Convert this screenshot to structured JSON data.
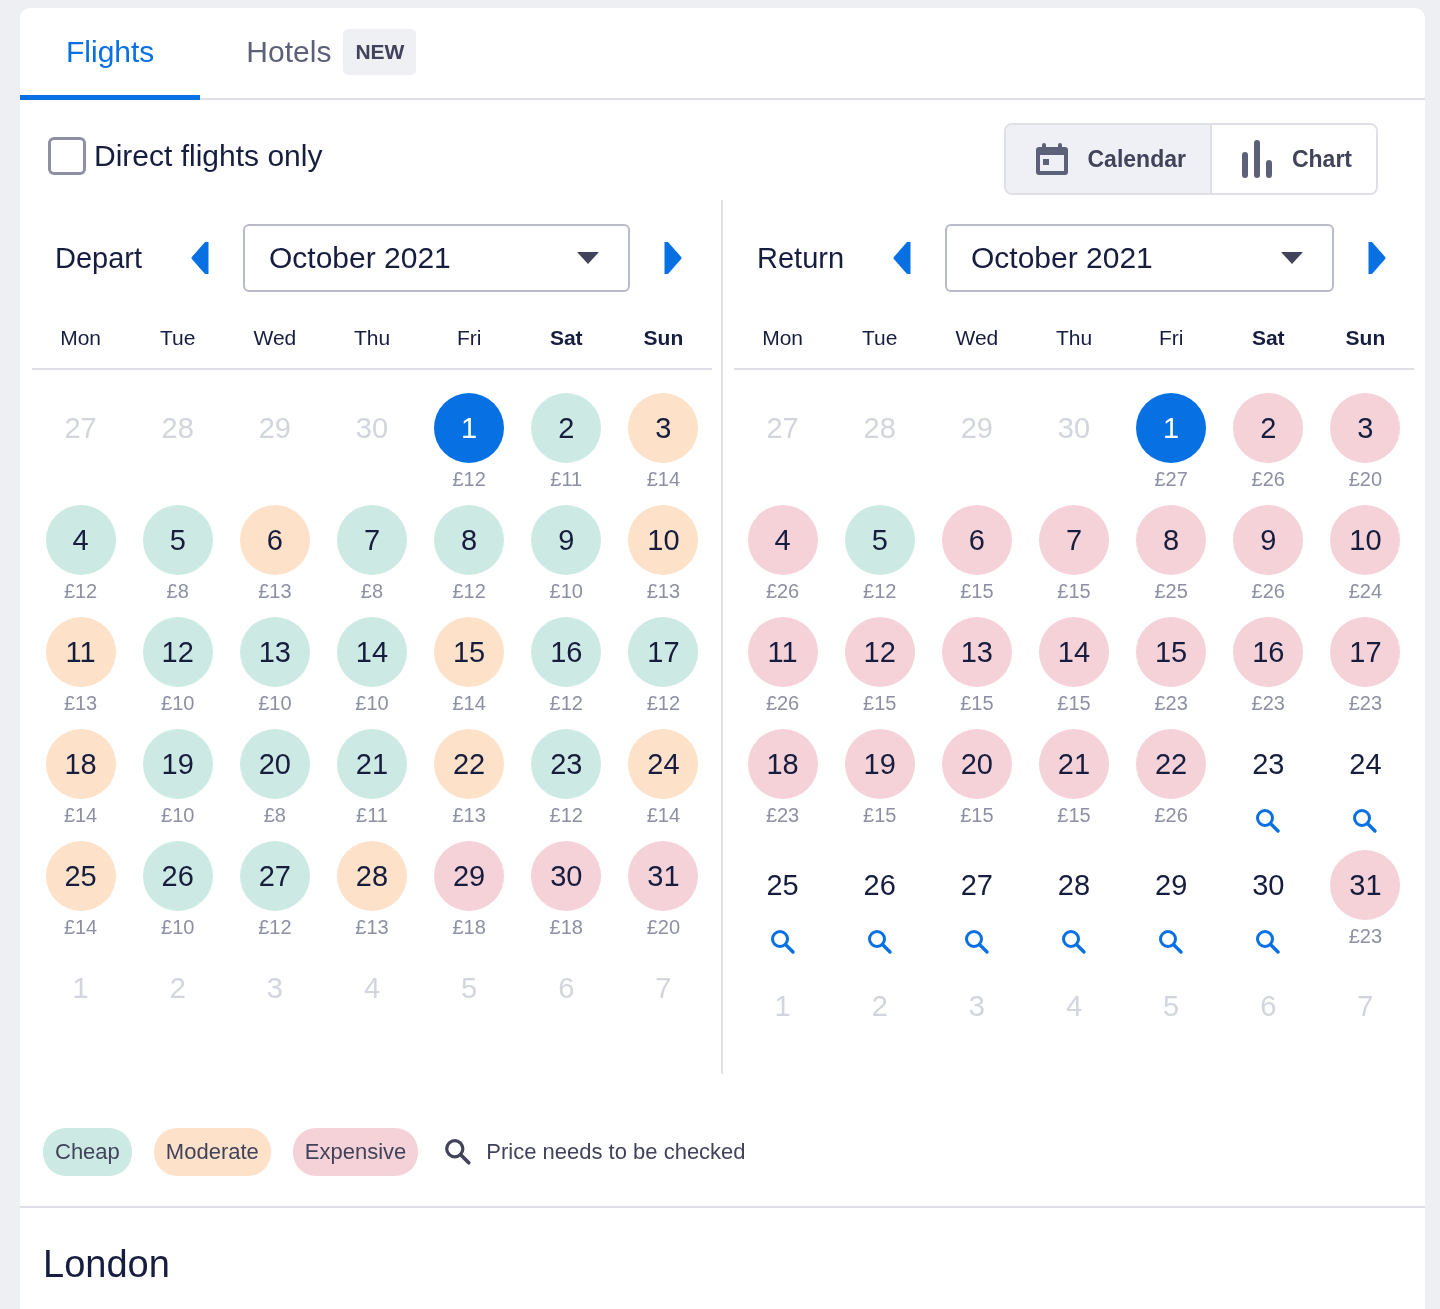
{
  "tabs": [
    {
      "label": "Flights",
      "selected": true
    },
    {
      "label": "Hotels",
      "selected": false,
      "badge": "NEW"
    }
  ],
  "direct_only": {
    "label": "Direct flights only",
    "checked": false
  },
  "view_toggle": [
    {
      "label": "Calendar",
      "kind": "calendar",
      "selected": true
    },
    {
      "label": "Chart",
      "kind": "chart",
      "selected": false
    }
  ],
  "calendars": [
    {
      "label": "Depart",
      "month": "October 2021",
      "weekdays": [
        {
          "label": "Mon",
          "weekend": false
        },
        {
          "label": "Tue",
          "weekend": false
        },
        {
          "label": "Wed",
          "weekend": false
        },
        {
          "label": "Thu",
          "weekend": false
        },
        {
          "label": "Fri",
          "weekend": false
        },
        {
          "label": "Sat",
          "weekend": true
        },
        {
          "label": "Sun",
          "weekend": true
        }
      ],
      "days": [
        {
          "day": "27",
          "kind": "outside",
          "selected": false
        },
        {
          "day": "28",
          "kind": "outside",
          "selected": false
        },
        {
          "day": "29",
          "kind": "outside",
          "selected": false
        },
        {
          "day": "30",
          "kind": "outside",
          "selected": false
        },
        {
          "day": "1",
          "kind": "plain",
          "price": "£12",
          "selected": true
        },
        {
          "day": "2",
          "kind": "cheap",
          "price": "£11",
          "selected": false
        },
        {
          "day": "3",
          "kind": "moderate",
          "price": "£14",
          "selected": false
        },
        {
          "day": "4",
          "kind": "cheap",
          "price": "£12",
          "selected": false
        },
        {
          "day": "5",
          "kind": "cheap",
          "price": "£8",
          "selected": false
        },
        {
          "day": "6",
          "kind": "moderate",
          "price": "£13",
          "selected": false
        },
        {
          "day": "7",
          "kind": "cheap",
          "price": "£8",
          "selected": false
        },
        {
          "day": "8",
          "kind": "cheap",
          "price": "£12",
          "selected": false
        },
        {
          "day": "9",
          "kind": "cheap",
          "price": "£10",
          "selected": false
        },
        {
          "day": "10",
          "kind": "moderate",
          "price": "£13",
          "selected": false
        },
        {
          "day": "11",
          "kind": "moderate",
          "price": "£13",
          "selected": false
        },
        {
          "day": "12",
          "kind": "cheap",
          "price": "£10",
          "selected": false
        },
        {
          "day": "13",
          "kind": "cheap",
          "price": "£10",
          "selected": false
        },
        {
          "day": "14",
          "kind": "cheap",
          "price": "£10",
          "selected": false
        },
        {
          "day": "15",
          "kind": "moderate",
          "price": "£14",
          "selected": false
        },
        {
          "day": "16",
          "kind": "cheap",
          "price": "£12",
          "selected": false
        },
        {
          "day": "17",
          "kind": "cheap",
          "price": "£12",
          "selected": false
        },
        {
          "day": "18",
          "kind": "moderate",
          "price": "£14",
          "selected": false
        },
        {
          "day": "19",
          "kind": "cheap",
          "price": "£10",
          "selected": false
        },
        {
          "day": "20",
          "kind": "cheap",
          "price": "£8",
          "selected": false
        },
        {
          "day": "21",
          "kind": "cheap",
          "price": "£11",
          "selected": false
        },
        {
          "day": "22",
          "kind": "moderate",
          "price": "£13",
          "selected": false
        },
        {
          "day": "23",
          "kind": "cheap",
          "price": "£12",
          "selected": false
        },
        {
          "day": "24",
          "kind": "moderate",
          "price": "£14",
          "selected": false
        },
        {
          "day": "25",
          "kind": "moderate",
          "price": "£14",
          "selected": false
        },
        {
          "day": "26",
          "kind": "cheap",
          "price": "£10",
          "selected": false
        },
        {
          "day": "27",
          "kind": "cheap",
          "price": "£12",
          "selected": false
        },
        {
          "day": "28",
          "kind": "moderate",
          "price": "£13",
          "selected": false
        },
        {
          "day": "29",
          "kind": "expensive",
          "price": "£18",
          "selected": false
        },
        {
          "day": "30",
          "kind": "expensive",
          "price": "£18",
          "selected": false
        },
        {
          "day": "31",
          "kind": "expensive",
          "price": "£20",
          "selected": false
        },
        {
          "day": "1",
          "kind": "outside",
          "selected": false
        },
        {
          "day": "2",
          "kind": "outside",
          "selected": false
        },
        {
          "day": "3",
          "kind": "outside",
          "selected": false
        },
        {
          "day": "4",
          "kind": "outside",
          "selected": false
        },
        {
          "day": "5",
          "kind": "outside",
          "selected": false
        },
        {
          "day": "6",
          "kind": "outside",
          "selected": false
        },
        {
          "day": "7",
          "kind": "outside",
          "selected": false
        }
      ]
    },
    {
      "label": "Return",
      "month": "October 2021",
      "weekdays": [
        {
          "label": "Mon",
          "weekend": false
        },
        {
          "label": "Tue",
          "weekend": false
        },
        {
          "label": "Wed",
          "weekend": false
        },
        {
          "label": "Thu",
          "weekend": false
        },
        {
          "label": "Fri",
          "weekend": false
        },
        {
          "label": "Sat",
          "weekend": true
        },
        {
          "label": "Sun",
          "weekend": true
        }
      ],
      "days": [
        {
          "day": "27",
          "kind": "outside",
          "selected": false
        },
        {
          "day": "28",
          "kind": "outside",
          "selected": false
        },
        {
          "day": "29",
          "kind": "outside",
          "selected": false
        },
        {
          "day": "30",
          "kind": "outside",
          "selected": false
        },
        {
          "day": "1",
          "kind": "plain",
          "price": "£27",
          "selected": true
        },
        {
          "day": "2",
          "kind": "expensive",
          "price": "£26",
          "selected": false
        },
        {
          "day": "3",
          "kind": "expensive",
          "price": "£20",
          "selected": false
        },
        {
          "day": "4",
          "kind": "expensive",
          "price": "£26",
          "selected": false
        },
        {
          "day": "5",
          "kind": "cheap",
          "price": "£12",
          "selected": false
        },
        {
          "day": "6",
          "kind": "expensive",
          "price": "£15",
          "selected": false
        },
        {
          "day": "7",
          "kind": "expensive",
          "price": "£15",
          "selected": false
        },
        {
          "day": "8",
          "kind": "expensive",
          "price": "£25",
          "selected": false
        },
        {
          "day": "9",
          "kind": "expensive",
          "price": "£26",
          "selected": false
        },
        {
          "day": "10",
          "kind": "expensive",
          "price": "£24",
          "selected": false
        },
        {
          "day": "11",
          "kind": "expensive",
          "price": "£26",
          "selected": false
        },
        {
          "day": "12",
          "kind": "expensive",
          "price": "£15",
          "selected": false
        },
        {
          "day": "13",
          "kind": "expensive",
          "price": "£15",
          "selected": false
        },
        {
          "day": "14",
          "kind": "expensive",
          "price": "£15",
          "selected": false
        },
        {
          "day": "15",
          "kind": "expensive",
          "price": "£23",
          "selected": false
        },
        {
          "day": "16",
          "kind": "expensive",
          "price": "£23",
          "selected": false
        },
        {
          "day": "17",
          "kind": "expensive",
          "price": "£23",
          "selected": false
        },
        {
          "day": "18",
          "kind": "expensive",
          "price": "£23",
          "selected": false
        },
        {
          "day": "19",
          "kind": "expensive",
          "price": "£15",
          "selected": false
        },
        {
          "day": "20",
          "kind": "expensive",
          "price": "£15",
          "selected": false
        },
        {
          "day": "21",
          "kind": "expensive",
          "price": "£15",
          "selected": false
        },
        {
          "day": "22",
          "kind": "expensive",
          "price": "£26",
          "selected": false
        },
        {
          "day": "23",
          "kind": "check",
          "selected": false
        },
        {
          "day": "24",
          "kind": "check",
          "selected": false
        },
        {
          "day": "25",
          "kind": "check",
          "selected": false
        },
        {
          "day": "26",
          "kind": "check",
          "selected": false
        },
        {
          "day": "27",
          "kind": "check",
          "selected": false
        },
        {
          "day": "28",
          "kind": "check",
          "selected": false
        },
        {
          "day": "29",
          "kind": "check",
          "selected": false
        },
        {
          "day": "30",
          "kind": "check",
          "selected": false
        },
        {
          "day": "31",
          "kind": "expensive",
          "price": "£23",
          "selected": false
        },
        {
          "day": "1",
          "kind": "outside",
          "selected": false
        },
        {
          "day": "2",
          "kind": "outside",
          "selected": false
        },
        {
          "day": "3",
          "kind": "outside",
          "selected": false
        },
        {
          "day": "4",
          "kind": "outside",
          "selected": false
        },
        {
          "day": "5",
          "kind": "outside",
          "selected": false
        },
        {
          "day": "6",
          "kind": "outside",
          "selected": false
        },
        {
          "day": "7",
          "kind": "outside",
          "selected": false
        }
      ]
    }
  ],
  "legend": [
    {
      "label": "Cheap",
      "kind": "chip",
      "color": "#cde9e3"
    },
    {
      "label": "Moderate",
      "kind": "chip",
      "color": "#fde2c9"
    },
    {
      "label": "Expensive",
      "kind": "chip",
      "color": "#f4d2d8"
    },
    {
      "label": "Price needs to be checked",
      "kind": "check"
    }
  ],
  "destination": "London"
}
